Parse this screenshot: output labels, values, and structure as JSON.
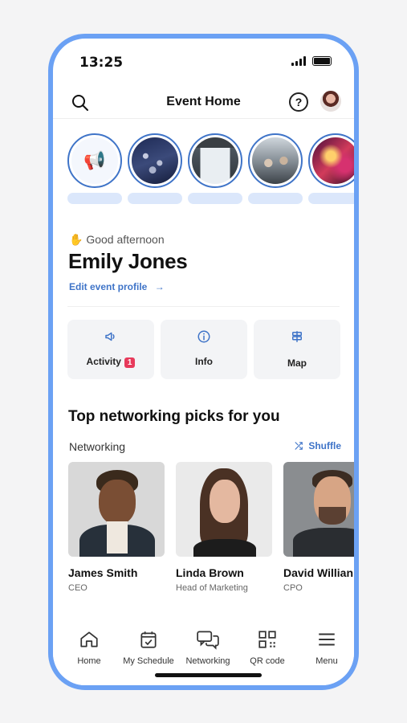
{
  "status_bar": {
    "time": "13:25"
  },
  "header": {
    "title": "Event Home"
  },
  "stories": [
    {
      "kind": "announcement"
    },
    {
      "kind": "photo"
    },
    {
      "kind": "photo"
    },
    {
      "kind": "photo"
    },
    {
      "kind": "photo"
    }
  ],
  "greeting": {
    "text": "Good afternoon",
    "name": "Emily Jones",
    "edit_link": "Edit event profile"
  },
  "tiles": [
    {
      "label": "Activity",
      "badge": "1",
      "icon": "megaphone-icon"
    },
    {
      "label": "Info",
      "icon": "info-icon"
    },
    {
      "label": "Map",
      "icon": "signpost-icon"
    }
  ],
  "networking": {
    "title": "Top networking picks for you",
    "label": "Networking",
    "shuffle": "Shuffle",
    "people": [
      {
        "name": "James Smith",
        "role": "CEO"
      },
      {
        "name": "Linda Brown",
        "role": "Head of Marketing"
      },
      {
        "name": "David Willian",
        "role": "CPO"
      }
    ]
  },
  "tabbar": [
    {
      "label": "Home",
      "icon": "home-icon"
    },
    {
      "label": "My Schedule",
      "icon": "calendar-icon"
    },
    {
      "label": "Networking",
      "icon": "chat-icon"
    },
    {
      "label": "QR code",
      "icon": "qr-icon"
    },
    {
      "label": "Menu",
      "icon": "menu-icon"
    }
  ],
  "colors": {
    "accent": "#3f74c8",
    "frame": "#6ba1f4",
    "badge": "#e73a5b"
  }
}
